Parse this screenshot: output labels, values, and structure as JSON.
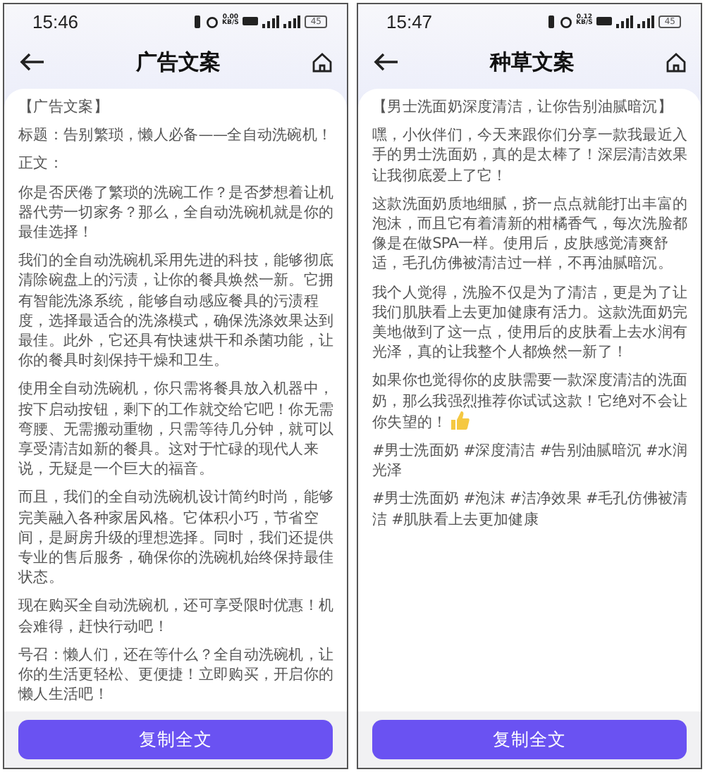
{
  "screens": [
    {
      "status_bar": {
        "time": "15:46",
        "speed": "0.00",
        "speed_unit": "KB/S",
        "battery": "45"
      },
      "title": "广告文案",
      "card": {
        "heading": "【广告文案】",
        "paragraphs": [
          {
            "text": "标题：告别繁琐，懒人必备——全自动洗碗机！"
          },
          {
            "text": "正文："
          },
          {
            "text": "你是否厌倦了繁琐的洗碗工作？是否梦想着让机器代劳一切家务？那么，全自动洗碗机就是你的最佳选择！"
          },
          {
            "text": "我们的全自动洗碗机采用先进的科技，能够彻底清除碗盘上的污渍，让你的餐具焕然一新。它拥有智能洗涤系统，能够自动感应餐具的污渍程度，选择最适合的洗涤模式，确保洗涤效果达到最佳。此外，它还具有快速烘干和杀菌功能，让你的餐具时刻保持干燥和卫生。"
          },
          {
            "text": "使用全自动洗碗机，你只需将餐具放入机器中，按下启动按钮，剩下的工作就交给它吧！你无需弯腰、无需搬动重物，只需等待几分钟，就可以享受清洁如新的餐具。这对于忙碌的现代人来说，无疑是一个巨大的福音。"
          },
          {
            "text": "而且，我们的全自动洗碗机设计简约时尚，能够完美融入各种家居风格。它体积小巧，节省空间，是厨房升级的理想选择。同时，我们还提供专业的售后服务，确保你的洗碗机始终保持最佳状态。"
          },
          {
            "text": "现在购买全自动洗碗机，还可享受限时优惠！机会难得，赶快行动吧！"
          },
          {
            "text": "号召：懒人们，还在等什么？全自动洗碗机，让你的生活更轻松、更便捷！立即购买，开启你的懒人生活吧！"
          }
        ]
      },
      "button": "复制全文"
    },
    {
      "status_bar": {
        "time": "15:47",
        "speed": "0.12",
        "speed_unit": "KB/S",
        "battery": "45"
      },
      "title": "种草文案",
      "card": {
        "heading": "【男士洗面奶深度清洁，让你告别油腻暗沉】",
        "paragraphs": [
          {
            "text": "嘿，小伙伴们，今天来跟你们分享一款我最近入手的男士洗面奶，真的是太棒了！深层清洁效果让我彻底爱上了它！"
          },
          {
            "text": "这款洗面奶质地细腻，挤一点点就能打出丰富的泡沫，而且它有着清新的柑橘香气，每次洗脸都像是在做SPA一样。使用后，皮肤感觉清爽舒适，毛孔仿佛被清洁过一样，不再油腻暗沉。"
          },
          {
            "text": "我个人觉得，洗脸不仅是为了清洁，更是为了让我们肌肤看上去更加健康有活力。这款洗面奶完美地做到了这一点，使用后的皮肤看上去水润有光泽，真的让我整个人都焕然一新了！"
          },
          {
            "text": "如果你也觉得你的皮肤需要一款深度清洁的洗面奶，那么我强烈推荐你试试这款！它绝对不会让你失望的！",
            "thumbs_up": true
          },
          {
            "text": "#男士洗面奶 #深度清洁 #告别油腻暗沉 #水润光泽"
          },
          {
            "text": "#男士洗面奶 #泡沫 #洁净效果 #毛孔仿佛被清洁 #肌肤看上去更加健康"
          }
        ]
      },
      "button": "复制全文"
    }
  ]
}
